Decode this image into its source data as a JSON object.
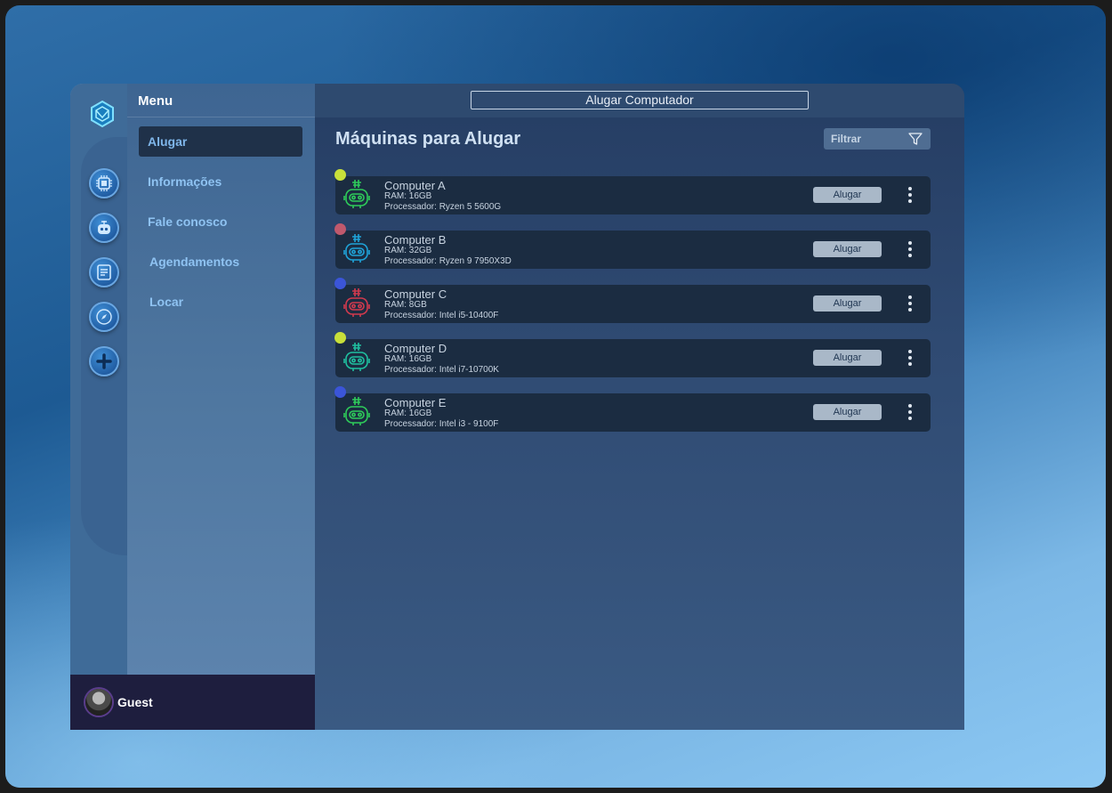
{
  "sidebar": {
    "menu_title": "Menu",
    "items": [
      {
        "label": "Alugar",
        "active": true
      },
      {
        "label": "Informações"
      },
      {
        "label": "Fale conosco"
      },
      {
        "label": "Agendamentos"
      },
      {
        "label": "Locar"
      }
    ],
    "rail_icons": [
      "hexagon-logo-icon",
      "cpu-icon",
      "robot-icon",
      "list-icon",
      "compass-icon",
      "plus-icon"
    ]
  },
  "user": {
    "name": "Guest"
  },
  "header": {
    "title": "Alugar Computador"
  },
  "main": {
    "title": "Máquinas para Alugar",
    "filter_label": "Filtrar",
    "rent_label": "Alugar",
    "computers": [
      {
        "name": "Computer A",
        "ram": "RAM: 16GB",
        "processor": "Processador: Ryzen 5 5600G",
        "status_color": "#c8e03a",
        "robot_color": "#2ecc5a"
      },
      {
        "name": "Computer B",
        "ram": "RAM: 32GB",
        "processor": "Processador: Ryzen 9 7950X3D",
        "status_color": "#c0596d",
        "robot_color": "#1fa3d9"
      },
      {
        "name": "Computer C",
        "ram": "RAM: 8GB",
        "processor": "Processador: Intel i5-10400F",
        "status_color": "#3b55d8",
        "robot_color": "#d23a4e"
      },
      {
        "name": "Computer D",
        "ram": "RAM: 16GB",
        "processor": "Processador: Intel i7-10700K",
        "status_color": "#c8e03a",
        "robot_color": "#1fc0a0"
      },
      {
        "name": "Computer E",
        "ram": "RAM: 16GB",
        "processor": "Processador: Intel i3 - 9100F",
        "status_color": "#3b55d8",
        "robot_color": "#2ecc5a"
      }
    ]
  }
}
